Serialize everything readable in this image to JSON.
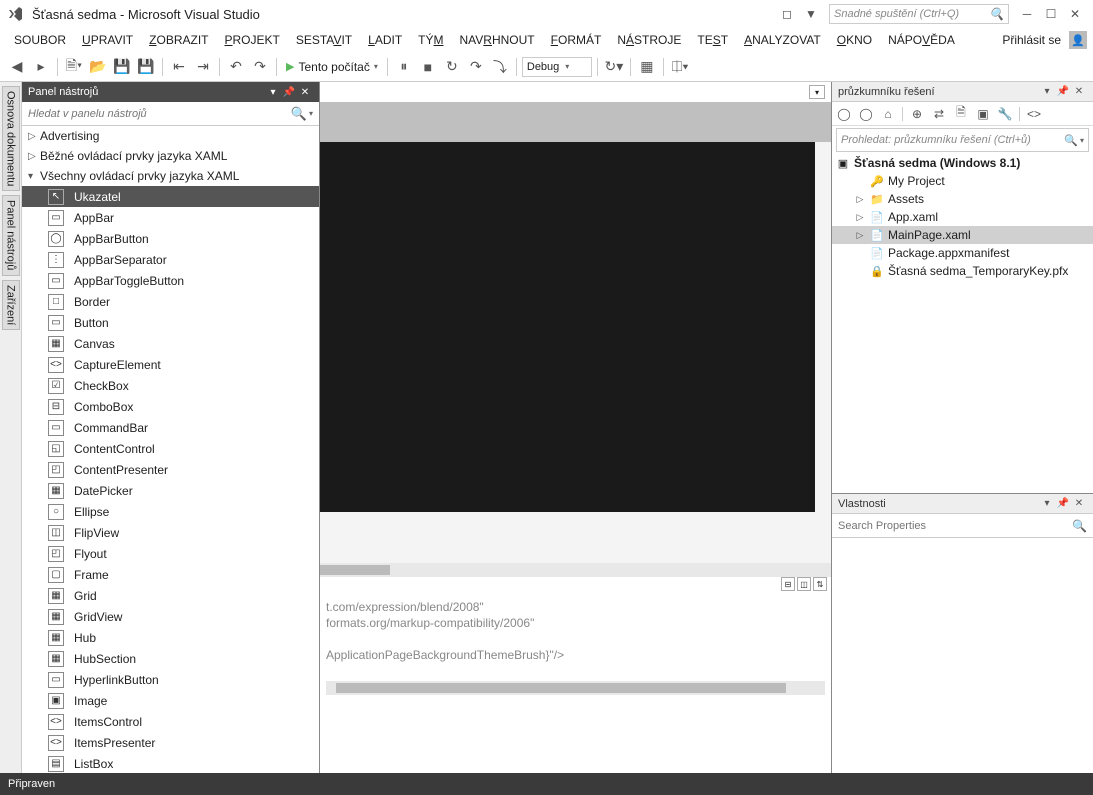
{
  "title": "Šťasná sedma - Microsoft Visual Studio",
  "quick_launch_placeholder": "Snadné spuštění (Ctrl+Q)",
  "menu": {
    "soubor": "SOUBOR",
    "upravit": "UPRAVIT",
    "zobrazit": "ZOBRAZIT",
    "projekt": "PROJEKT",
    "sestavit": "SESTAVIT",
    "ladit": "LADIT",
    "tym": "TÝM",
    "navrhnout": "NAVRHNOUT",
    "format": "FORMÁT",
    "nastroje": "NÁSTROJE",
    "test": "TEST",
    "analyzovat": "ANALYZOVAT",
    "okno": "OKNO",
    "napoveda": "NÁPOVĚDA",
    "signin": "Přihlásit se"
  },
  "toolbar": {
    "start_target": "Tento počítač",
    "config": "Debug"
  },
  "vtabs": {
    "osnova": "Osnova dokumentu",
    "panel": "Panel nástrojů",
    "zarizeni": "Zařízení"
  },
  "toolbox": {
    "title": "Panel nástrojů",
    "search_placeholder": "Hledat v panelu nástrojů",
    "cats": [
      {
        "label": "Advertising",
        "expanded": false
      },
      {
        "label": "Běžné ovládací prvky jazyka XAML",
        "expanded": false
      },
      {
        "label": "Všechny ovládací prvky jazyka XAML",
        "expanded": true
      }
    ],
    "items": [
      {
        "label": "Ukazatel",
        "selected": true,
        "glyph": "↖"
      },
      {
        "label": "AppBar",
        "glyph": "▭"
      },
      {
        "label": "AppBarButton",
        "glyph": "◯"
      },
      {
        "label": "AppBarSeparator",
        "glyph": "⋮"
      },
      {
        "label": "AppBarToggleButton",
        "glyph": "▭"
      },
      {
        "label": "Border",
        "glyph": "□"
      },
      {
        "label": "Button",
        "glyph": "▭"
      },
      {
        "label": "Canvas",
        "glyph": "▦"
      },
      {
        "label": "CaptureElement",
        "glyph": "<>"
      },
      {
        "label": "CheckBox",
        "glyph": "☑"
      },
      {
        "label": "ComboBox",
        "glyph": "⊟"
      },
      {
        "label": "CommandBar",
        "glyph": "▭"
      },
      {
        "label": "ContentControl",
        "glyph": "◱"
      },
      {
        "label": "ContentPresenter",
        "glyph": "◰"
      },
      {
        "label": "DatePicker",
        "glyph": "▦"
      },
      {
        "label": "Ellipse",
        "glyph": "○"
      },
      {
        "label": "FlipView",
        "glyph": "◫"
      },
      {
        "label": "Flyout",
        "glyph": "◰"
      },
      {
        "label": "Frame",
        "glyph": "▢"
      },
      {
        "label": "Grid",
        "glyph": "▦"
      },
      {
        "label": "GridView",
        "glyph": "▦"
      },
      {
        "label": "Hub",
        "glyph": "▦"
      },
      {
        "label": "HubSection",
        "glyph": "▦"
      },
      {
        "label": "HyperlinkButton",
        "glyph": "▭"
      },
      {
        "label": "Image",
        "glyph": "▣"
      },
      {
        "label": "ItemsControl",
        "glyph": "<>"
      },
      {
        "label": "ItemsPresenter",
        "glyph": "<>"
      },
      {
        "label": "ListBox",
        "glyph": "▤"
      }
    ]
  },
  "code": {
    "l1": "t.com/expression/blend/2008\"",
    "l2": "formats.org/markup-compatibility/2006\"",
    "l3": " ",
    "l4": "ApplicationPageBackgroundThemeBrush}\"/>"
  },
  "solution": {
    "title": "průzkumníku řešení",
    "search_placeholder": "Prohledat: průzkumníku řešení (Ctrl+ů)",
    "root": "Šťasná sedma (Windows 8.1)",
    "items": [
      {
        "label": "My Project",
        "indent": 1,
        "glyph": "🔑"
      },
      {
        "label": "Assets",
        "indent": 1,
        "glyph": "📁",
        "exp": "▷"
      },
      {
        "label": "App.xaml",
        "indent": 1,
        "glyph": "📄",
        "exp": "▷"
      },
      {
        "label": "MainPage.xaml",
        "indent": 1,
        "glyph": "📄",
        "exp": "▷",
        "selected": true
      },
      {
        "label": "Package.appxmanifest",
        "indent": 1,
        "glyph": "📄"
      },
      {
        "label": "Šťasná sedma_TemporaryKey.pfx",
        "indent": 1,
        "glyph": "🔒"
      }
    ]
  },
  "properties": {
    "title": "Vlastnosti",
    "search_placeholder": "Search Properties"
  },
  "status": "Připraven"
}
